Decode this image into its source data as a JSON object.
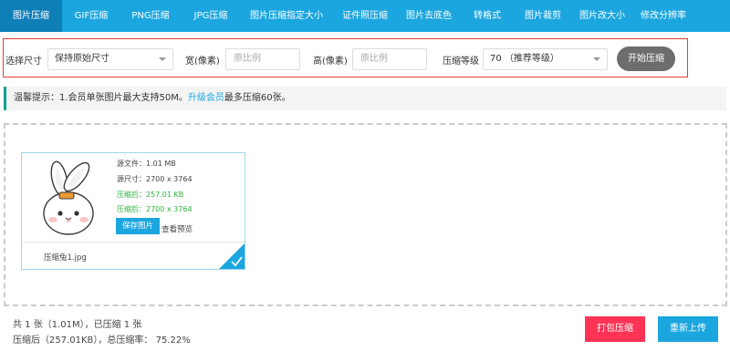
{
  "tabs": [
    {
      "label": "图片压缩",
      "active": true
    },
    {
      "label": "GIF压缩",
      "active": false
    },
    {
      "label": "PNG压缩",
      "active": false
    },
    {
      "label": "JPG压缩",
      "active": false
    },
    {
      "label": "图片压缩指定大小",
      "active": false
    },
    {
      "label": "证件照压缩",
      "active": false
    },
    {
      "label": "图片去底色",
      "active": false
    },
    {
      "label": "转格式",
      "active": false
    },
    {
      "label": "图片裁剪",
      "active": false
    },
    {
      "label": "图片改大小",
      "active": false
    },
    {
      "label": "修改分辨率",
      "active": false
    }
  ],
  "options": {
    "size_label": "选择尺寸",
    "size_value": "保持原始尺寸",
    "width_label": "宽(像素)",
    "width_placeholder": "原比例",
    "height_label": "高(像素)",
    "height_placeholder": "原比例",
    "level_label": "压缩等级",
    "level_value": "70 （推荐等级）",
    "start_button": "开始压缩"
  },
  "tip": {
    "prefix": "温馨提示：1.会员单张图片最大支持50M。",
    "link": "升级会员",
    "suffix": "最多压缩60张。"
  },
  "file": {
    "source_file": "源文件：1.01 MB",
    "source_size": "源尺寸：2700 x 3764",
    "compressed_file": "压缩后：257.01 KB",
    "compressed_size": "压缩后：2700 x 3764",
    "save_button": "保存图片",
    "preview_link": "查看预览",
    "name": "压缩兔1.jpg"
  },
  "summary": {
    "line1": "共 1 张（1.01M），已压缩 1 张",
    "line2": "压缩后（257.01KB），总压缩率： 75.22%"
  },
  "buttons": {
    "pack": "打包压缩",
    "reupload": "重新上传"
  },
  "colors": {
    "accent": "#1ba6df",
    "active_tab": "#0f7fb8",
    "pack_button": "#ff3355",
    "success": "#2bb33b",
    "highlight_border": "#e53935"
  },
  "icons": {
    "thumbnail": "bunny-illustration",
    "selected": "check-icon"
  }
}
